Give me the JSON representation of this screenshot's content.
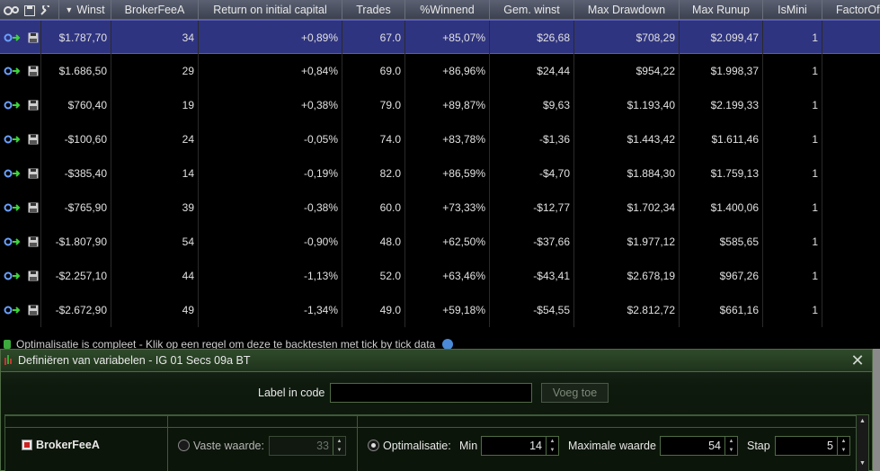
{
  "header": {
    "tools_icons": [
      "gears-icon",
      "save-icon",
      "wrench-icon"
    ],
    "columns": [
      "Winst",
      "BrokerFeeA",
      "Return on initial capital",
      "Trades",
      "%Winnend",
      "Gem. winst",
      "Max Drawdown",
      "Max Runup",
      "IsMini",
      "FactorOf"
    ]
  },
  "rows": [
    [
      "$1.787,70",
      "34",
      "+0,89%",
      "67.0",
      "+85,07%",
      "$26,68",
      "$708,29",
      "$2.099,47",
      "1"
    ],
    [
      "$1.686,50",
      "29",
      "+0,84%",
      "69.0",
      "+86,96%",
      "$24,44",
      "$954,22",
      "$1.998,37",
      "1"
    ],
    [
      "$760,40",
      "19",
      "+0,38%",
      "79.0",
      "+89,87%",
      "$9,63",
      "$1.193,40",
      "$2.199,33",
      "1"
    ],
    [
      "-$100,60",
      "24",
      "-0,05%",
      "74.0",
      "+83,78%",
      "-$1,36",
      "$1.443,42",
      "$1.611,46",
      "1"
    ],
    [
      "-$385,40",
      "14",
      "-0,19%",
      "82.0",
      "+86,59%",
      "-$4,70",
      "$1.884,30",
      "$1.759,13",
      "1"
    ],
    [
      "-$765,90",
      "39",
      "-0,38%",
      "60.0",
      "+73,33%",
      "-$12,77",
      "$1.702,34",
      "$1.400,06",
      "1"
    ],
    [
      "-$1.807,90",
      "54",
      "-0,90%",
      "48.0",
      "+62,50%",
      "-$37,66",
      "$1.977,12",
      "$585,65",
      "1"
    ],
    [
      "-$2.257,10",
      "44",
      "-1,13%",
      "52.0",
      "+63,46%",
      "-$43,41",
      "$2.678,19",
      "$967,26",
      "1"
    ],
    [
      "-$2.672,90",
      "49",
      "-1,34%",
      "49.0",
      "+59,18%",
      "-$54,55",
      "$2.812,72",
      "$661,16",
      "1"
    ]
  ],
  "status": {
    "text": "Optimalisatie is compleet - Klik op een regel om deze te backtesten met tick by tick data"
  },
  "dialog": {
    "title": "Definiëren van variabelen - IG 01 Secs 09a BT",
    "label_in_code": "Label in code",
    "label_value": "",
    "add_button": "Voeg toe",
    "variable_name": "BrokerFeeA",
    "fixed_label": "Vaste waarde:",
    "fixed_value": "33",
    "opt_label": "Optimalisatie:",
    "min_label": "Min",
    "min_value": "14",
    "max_label": "Maximale waarde",
    "max_value": "54",
    "step_label": "Stap",
    "step_value": "5"
  },
  "colors": {
    "selected_row": "#2f3480",
    "dialog_bg": "#0f1a0e",
    "header_bg": "#4a4f5e"
  }
}
